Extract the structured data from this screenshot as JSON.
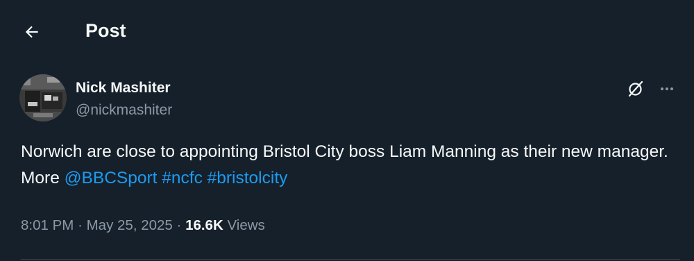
{
  "header": {
    "title": "Post",
    "back_icon": "arrow-left-icon"
  },
  "author": {
    "name": "Nick Mashiter",
    "handle": "@nickmashiter",
    "avatar_icon": "profile-photo"
  },
  "actions": {
    "grok_icon": "grok-icon",
    "more_icon": "more-dots-icon"
  },
  "tweet": {
    "text_plain": "Norwich are close to appointing Bristol City boss Liam Manning as their new manager. More",
    "mention": "@BBCSport",
    "hashtag1": "#ncfc",
    "hashtag2": "#bristolcity"
  },
  "meta": {
    "time": "8:01 PM",
    "separator": "·",
    "date": "May 25, 2025",
    "views_count": "16.6K",
    "views_label": "Views"
  },
  "colors": {
    "background": "#15202b",
    "text": "#f7f9f9",
    "secondary": "#8b98a5",
    "link": "#1d9bf0",
    "divider": "#38444d"
  }
}
